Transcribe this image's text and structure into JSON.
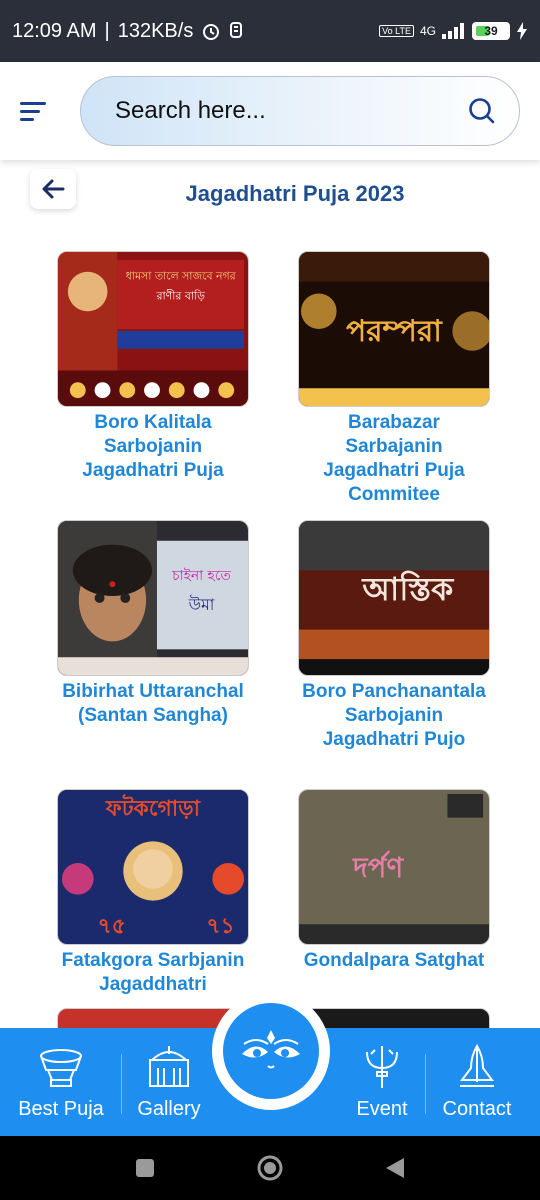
{
  "status_bar": {
    "time": "12:09 AM",
    "speed": "132KB/s",
    "network": "4G",
    "volte": "Vo LTE",
    "battery": "39"
  },
  "search": {
    "placeholder": "Search here..."
  },
  "page": {
    "title": "Jagadhatri Puja 2023"
  },
  "cards": [
    {
      "name": "Boro Kalitala Sarbojanin Jagadhatri Puja",
      "poster_text": "ধামসা তালে সাজবে নগর রাণীর বাড়ি",
      "colors": [
        "#8a1212",
        "#f7d27a"
      ]
    },
    {
      "name": "Barabazar Sarbajanin Jagadhatri Puja Commitee",
      "poster_text": "পরম্পরা",
      "colors": [
        "#1b0c06",
        "#f0b040"
      ]
    },
    {
      "name": "Bibirhat Uttaranchal (Santan Sangha)",
      "poster_text": "চাইনা হতে উমা",
      "colors": [
        "#2c2b31",
        "#e8e0d8"
      ]
    },
    {
      "name": "Boro Panchanantala Sarbojanin Jagadhatri Pujo",
      "poster_text": "আস্তিক",
      "colors": [
        "#5a1a10",
        "#f1e6dc"
      ]
    },
    {
      "name": "Fatakgora Sarbjanin Jagaddhatri",
      "poster_text": "ফটকগোড়া ৭৫",
      "colors": [
        "#1a2a6c",
        "#e54b2a"
      ]
    },
    {
      "name": "Gondalpara Satghat",
      "poster_text": "দর্পণ",
      "colors": [
        "#6b6552",
        "#e67fa8"
      ]
    }
  ],
  "nav": {
    "items": [
      {
        "label": "Best Puja",
        "icon": "trophy-icon"
      },
      {
        "label": "Gallery",
        "icon": "temple-icon"
      },
      {
        "label": "Event",
        "icon": "trident-icon"
      },
      {
        "label": "Contact",
        "icon": "namaste-icon"
      }
    ],
    "center_icon": "durga-eyes-icon",
    "color": "#1e8ef0"
  }
}
